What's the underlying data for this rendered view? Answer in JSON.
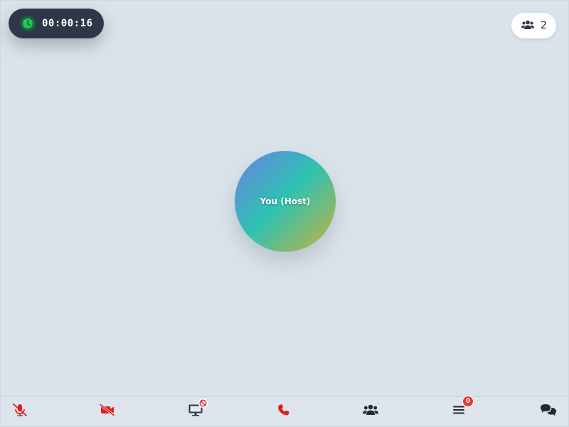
{
  "timer": {
    "elapsed": "00:00:16",
    "icon": "clock-icon",
    "accent": "#22c55e"
  },
  "participants": {
    "count": "2",
    "icon": "users-icon"
  },
  "main_tile": {
    "label": "You (Host)"
  },
  "controls": {
    "mute": {
      "icon": "microphone-slash-icon",
      "color": "#e11d1d"
    },
    "video": {
      "icon": "video-slash-icon",
      "color": "#e11d1d"
    },
    "screen_share": {
      "icon": "desktop-icon",
      "status_icon": "blocked-icon"
    },
    "end_call": {
      "icon": "phone-icon",
      "color": "#e11d1d"
    },
    "participants": {
      "icon": "users-icon"
    },
    "menu": {
      "icon": "bars-icon",
      "badge": "0"
    },
    "chat": {
      "icon": "comments-icon"
    }
  }
}
